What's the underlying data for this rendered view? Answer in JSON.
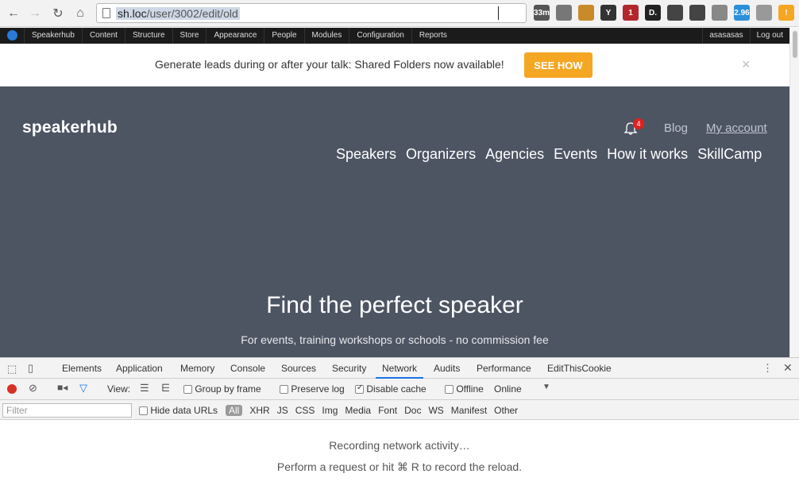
{
  "browser": {
    "url_host": "sh.loc",
    "url_path": "/user/3002/edit/old",
    "extensions": [
      {
        "name": "timer-33m-icon",
        "label": "33m",
        "color": "#555"
      },
      {
        "name": "gear-ext-icon",
        "label": "",
        "color": "#777"
      },
      {
        "name": "cookie-icon",
        "label": "",
        "color": "#c98a2a"
      },
      {
        "name": "y-ext-icon",
        "label": "Y",
        "color": "#333"
      },
      {
        "name": "shield-ext-icon",
        "label": "1",
        "color": "#b3262b"
      },
      {
        "name": "d-ext-icon",
        "label": "D.",
        "color": "#222"
      },
      {
        "name": "circle-ext-icon",
        "label": "",
        "color": "#444"
      },
      {
        "name": "tool-ext-icon",
        "label": "",
        "color": "#444"
      },
      {
        "name": "image-ext-icon",
        "label": "",
        "color": "#888"
      },
      {
        "name": "cloud-2-96-icon",
        "label": "2.96",
        "color": "#2d8fd8"
      },
      {
        "name": "vue-ext-icon",
        "label": "",
        "color": "#999"
      },
      {
        "name": "warning-ext-icon",
        "label": "!",
        "color": "#f5a623"
      }
    ]
  },
  "admin_bar": {
    "items": [
      "Speakerhub",
      "Content",
      "Structure",
      "Store",
      "Appearance",
      "People",
      "Modules",
      "Configuration",
      "Reports"
    ],
    "user": "asasasas",
    "logout": "Log out"
  },
  "announcement": {
    "text": "Generate leads during or after your talk: Shared Folders now available!",
    "button": "SEE HOW",
    "close": "×"
  },
  "site": {
    "logo": "speakerhub",
    "notifications": "4",
    "blog": "Blog",
    "my_account": "My account",
    "nav": [
      "Speakers",
      "Organizers",
      "Agencies",
      "Events",
      "How it works",
      "SkillCamp"
    ],
    "hero_title": "Find the perfect speaker",
    "hero_subtitle": "For events, training workshops or schools - no commission fee"
  },
  "devtools": {
    "tabs": [
      "Elements",
      "Application",
      "Memory",
      "Console",
      "Sources",
      "Security",
      "Network",
      "Audits",
      "Performance",
      "EditThisCookie"
    ],
    "active_tab": "Network",
    "view_label": "View:",
    "group_by_frame": "Group by frame",
    "preserve_log": "Preserve log",
    "disable_cache": "Disable cache",
    "offline": "Offline",
    "throttle": "Online",
    "filter_placeholder": "Filter",
    "hide_data_urls": "Hide data URLs",
    "types": [
      "All",
      "XHR",
      "JS",
      "CSS",
      "Img",
      "Media",
      "Font",
      "Doc",
      "WS",
      "Manifest",
      "Other"
    ],
    "empty_line1": "Recording network activity…",
    "empty_line2": "Perform a request or hit ⌘ R to record the reload."
  },
  "colors": {
    "hero_bg": "#4d5563",
    "accent_button": "#f5a623",
    "badge": "#e02020",
    "record": "#d93025"
  }
}
